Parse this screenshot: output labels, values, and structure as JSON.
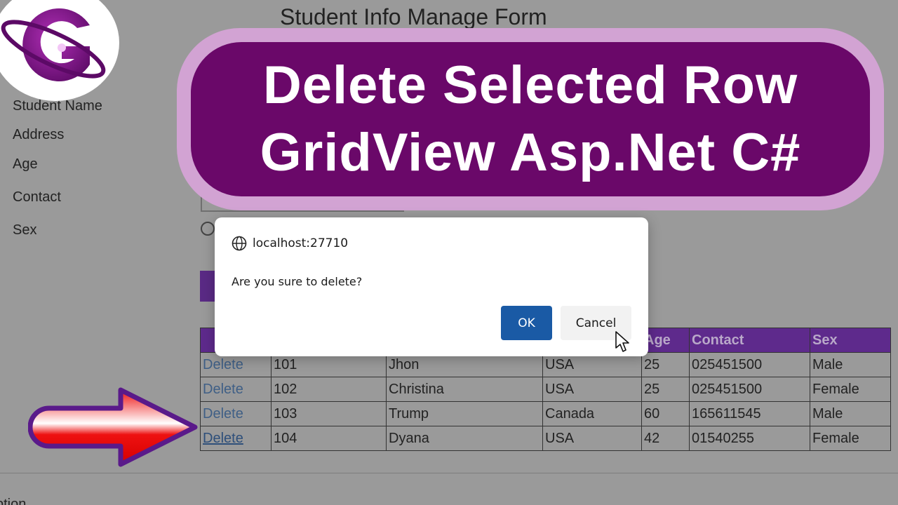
{
  "page": {
    "title": "Student Info Manage Form",
    "footer_text": "ption"
  },
  "form": {
    "labels": [
      "Student Name",
      "Address",
      "Age",
      "Contact",
      "Sex"
    ]
  },
  "banner": {
    "line1": "Delete Selected Row",
    "line2": "GridView Asp.Net C#"
  },
  "dialog": {
    "origin": "localhost:27710",
    "message": "Are you sure to delete?",
    "ok_label": "OK",
    "cancel_label": "Cancel"
  },
  "grid": {
    "headers": [
      "",
      "",
      "",
      "",
      "Age",
      "Contact",
      "Sex"
    ],
    "rows": [
      {
        "action": "Delete",
        "id": "101",
        "name": "Jhon",
        "country": "USA",
        "age": "25",
        "contact": "025451500",
        "sex": "Male"
      },
      {
        "action": "Delete",
        "id": "102",
        "name": "Christina",
        "country": "USA",
        "age": "25",
        "contact": "025451500",
        "sex": "Female"
      },
      {
        "action": "Delete",
        "id": "103",
        "name": "Trump",
        "country": "Canada",
        "age": "60",
        "contact": "165611545",
        "sex": "Male"
      },
      {
        "action": "Delete",
        "id": "104",
        "name": "Dyana",
        "country": "USA",
        "age": "42",
        "contact": "01540255",
        "sex": "Female"
      }
    ]
  },
  "colors": {
    "banner_bg": "#6a0869",
    "banner_border": "#d2a3d3",
    "grid_header": "#5e2a8c",
    "ok_button": "#1a5aa5",
    "arrow_fill": "#ee1111",
    "arrow_outline": "#5a1a8a"
  },
  "icons": {
    "logo": "logo-g-icon",
    "origin": "globe-icon",
    "pointer": "mouse-cursor-icon",
    "arrow": "red-arrow-icon"
  }
}
